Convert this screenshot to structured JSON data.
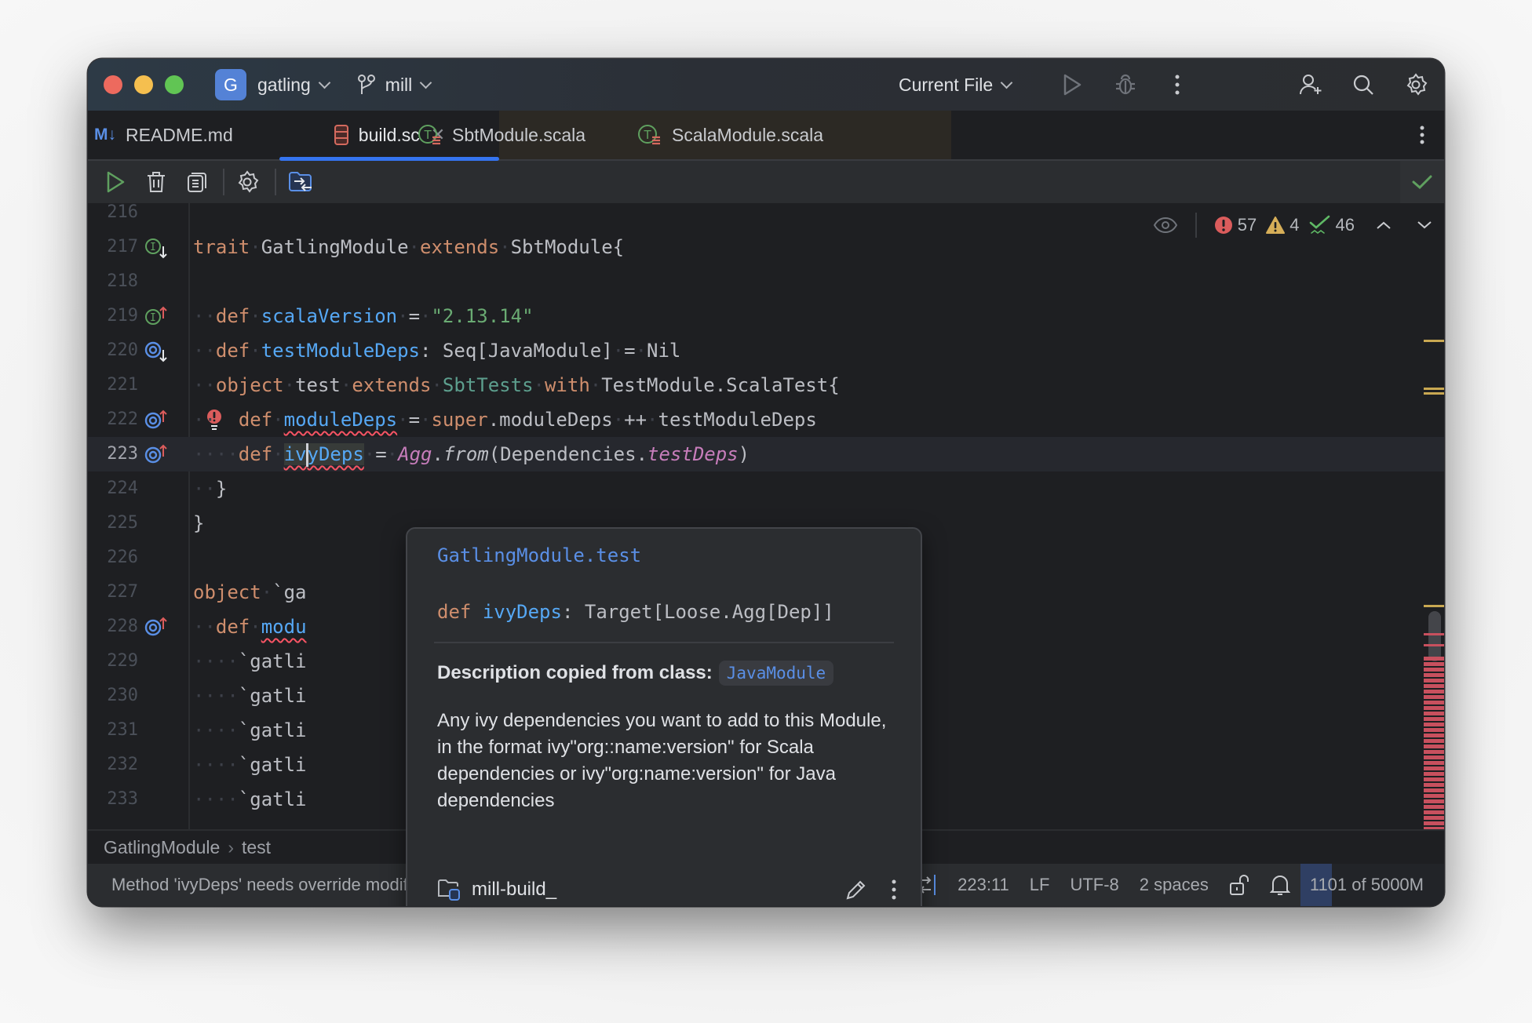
{
  "titlebar": {
    "project_initial": "G",
    "project_name": "gatling",
    "branch": "mill",
    "run_config": "Current File",
    "icons": [
      "run-icon",
      "debug-icon",
      "more-icon",
      "add-user-icon",
      "search-icon",
      "settings-icon"
    ]
  },
  "tabs": [
    {
      "label": "README.md",
      "icon": "markdown-icon",
      "active": false
    },
    {
      "label": "build.sc",
      "icon": "build-script-icon",
      "active": true,
      "closable": true
    },
    {
      "label": "SbtModule.scala",
      "icon": "scala-trait-icon",
      "active": false
    },
    {
      "label": "ScalaModule.scala",
      "icon": "scala-trait-icon",
      "active": false
    }
  ],
  "toolbar": {
    "icons": [
      "run-icon",
      "delete-icon",
      "copy-icon",
      "settings-icon",
      "load-script-icon"
    ]
  },
  "inspections": {
    "errors": "57",
    "warnings": "4",
    "weak_warnings": "46"
  },
  "editor": {
    "lines": [
      {
        "num": "216"
      },
      {
        "num": "217"
      },
      {
        "num": "218"
      },
      {
        "num": "219"
      },
      {
        "num": "220"
      },
      {
        "num": "221"
      },
      {
        "num": "222"
      },
      {
        "num": "223"
      },
      {
        "num": "224"
      },
      {
        "num": "225"
      },
      {
        "num": "226"
      },
      {
        "num": "227"
      },
      {
        "num": "228"
      },
      {
        "num": "229"
      },
      {
        "num": "230"
      },
      {
        "num": "231"
      },
      {
        "num": "232"
      },
      {
        "num": "233"
      }
    ],
    "tokens": {
      "l217": [
        "trait",
        "GatlingModule",
        "extends",
        "SbtModule{"
      ],
      "l219": [
        "def",
        "scalaVersion",
        "=",
        "\"2.13.14\""
      ],
      "l220": [
        "def",
        "testModuleDeps",
        ": Seq[JavaModule]",
        "=",
        "Nil"
      ],
      "l221": [
        "object",
        "test",
        "extends",
        "SbtTests",
        "with",
        "TestModule.ScalaTest{"
      ],
      "l222": [
        "def",
        "moduleDeps",
        "=",
        "super",
        ".moduleDeps",
        "++",
        "testModuleDeps"
      ],
      "l223": [
        "def",
        "iv",
        "yDeps",
        "=",
        "Agg",
        ".",
        "from",
        "(Dependencies.",
        "testDeps",
        ")"
      ],
      "l224": "}",
      "l225": "}",
      "l227": [
        "object",
        "`ga"
      ],
      "l228": [
        "def",
        "modu"
      ],
      "l229": "`gatli",
      "l230": "`gatli",
      "l231": "`gatli",
      "l232": "`gatli",
      "l233": "`gatli"
    }
  },
  "breadcrumb": [
    "GatlingModule",
    "test"
  ],
  "popup": {
    "header": "GatlingModule.test",
    "sig_kw": "def",
    "sig_name": "ivyDeps",
    "sig_type": ": Target[Loose.Agg[Dep]]",
    "desc_label": "Description copied from class:",
    "desc_class": "JavaModule",
    "body": "Any ivy dependencies you want to add to this Module, in the format ivy\"org::name:version\" for Scala dependencies or ivy\"org:name:version\" for Java dependencies",
    "module": "mill-build_"
  },
  "status": {
    "message": "Method 'ivyDeps' needs override modifier",
    "position": "223:11",
    "line_sep": "LF",
    "encoding": "UTF-8",
    "indent": "2 spaces",
    "memory": "1101 of 5000M",
    "memory_fraction": 0.22
  },
  "colors": {
    "accent": "#3574f0",
    "error": "#db5c5c",
    "warning": "#d6ae58",
    "ok": "#5fb865"
  }
}
